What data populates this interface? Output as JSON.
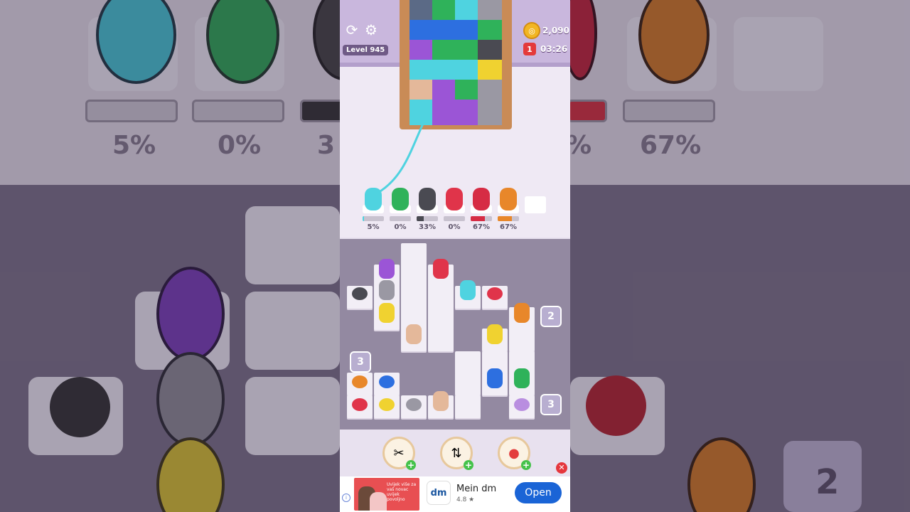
{
  "hud": {
    "level": "Level 945",
    "coins": "2,090",
    "lives": "1",
    "timer": "03:26",
    "restart_icon": "restart-icon",
    "settings_icon": "gear-icon"
  },
  "colors": {
    "cyan": "#4fd3e0",
    "green": "#2fb25a",
    "dark": "#4a4a52",
    "red": "#e0344a",
    "crimson": "#d62c44",
    "orange": "#e8872a",
    "purple": "#9b55d6",
    "gray": "#9a98a3",
    "yellow": "#f0d230",
    "tan": "#e4b89a",
    "blue": "#2d6fe0",
    "lilac": "#b98ee0"
  },
  "slots": [
    {
      "color": "#4fd3e0",
      "percent": "5%",
      "progress": 0.05
    },
    {
      "color": "#2fb25a",
      "percent": "0%",
      "progress": 0.0
    },
    {
      "color": "#4a4a52",
      "percent": "33%",
      "progress": 0.33
    },
    {
      "color": "#e0344a",
      "percent": "0%",
      "progress": 0.0
    },
    {
      "color": "#d62c44",
      "percent": "67%",
      "progress": 0.67
    },
    {
      "color": "#e8872a",
      "percent": "67%",
      "progress": 0.67
    },
    {
      "color": "",
      "percent": "",
      "progress": null
    }
  ],
  "tunnels": [
    "2",
    "3",
    "3"
  ],
  "boosters": [
    {
      "name": "scissors",
      "icon": "scissors-icon",
      "glyph": "✂"
    },
    {
      "name": "spool-swap",
      "icon": "spool-swap-icon",
      "glyph": "⇅"
    },
    {
      "name": "balloon",
      "icon": "balloon-icon",
      "glyph": "●"
    }
  ],
  "ad": {
    "app_name": "Mein dm",
    "rating": "4.8 ★",
    "logo_text": "dm",
    "button_label": "Open",
    "image_text": "Uvijek više za vaš novac uvijek povoljno"
  },
  "side_percents": {
    "left": [
      "5%",
      "0%",
      "3"
    ],
    "right": [
      "%",
      "67%"
    ]
  },
  "side_tunnel": "2"
}
